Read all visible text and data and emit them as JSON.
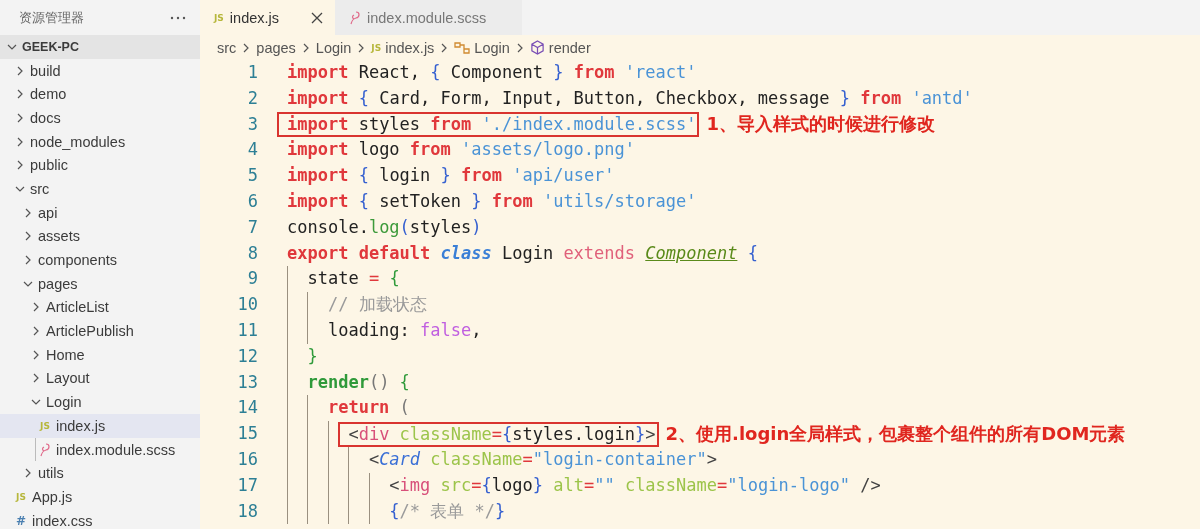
{
  "sidebar": {
    "title": "资源管理器",
    "tree": [
      {
        "label": "GEEK-PC",
        "kind": "root",
        "expanded": true,
        "selected": false,
        "children": [
          {
            "label": "build",
            "kind": "folder",
            "expanded": false,
            "selected": false
          },
          {
            "label": "demo",
            "kind": "folder",
            "expanded": false,
            "selected": false
          },
          {
            "label": "docs",
            "kind": "folder",
            "expanded": false,
            "selected": false
          },
          {
            "label": "node_modules",
            "kind": "folder",
            "expanded": false,
            "selected": false
          },
          {
            "label": "public",
            "kind": "folder",
            "expanded": false,
            "selected": false
          },
          {
            "label": "src",
            "kind": "folder",
            "expanded": true,
            "selected": false,
            "children": [
              {
                "label": "api",
                "kind": "folder",
                "expanded": false,
                "selected": false
              },
              {
                "label": "assets",
                "kind": "folder",
                "expanded": false,
                "selected": false
              },
              {
                "label": "components",
                "kind": "folder",
                "expanded": false,
                "selected": false
              },
              {
                "label": "pages",
                "kind": "folder",
                "expanded": true,
                "selected": false,
                "children": [
                  {
                    "label": "ArticleList",
                    "kind": "folder",
                    "expanded": false,
                    "selected": false
                  },
                  {
                    "label": "ArticlePublish",
                    "kind": "folder",
                    "expanded": false,
                    "selected": false
                  },
                  {
                    "label": "Home",
                    "kind": "folder",
                    "expanded": false,
                    "selected": false
                  },
                  {
                    "label": "Layout",
                    "kind": "folder",
                    "expanded": false,
                    "selected": false
                  },
                  {
                    "label": "Login",
                    "kind": "folder",
                    "expanded": true,
                    "selected": false,
                    "children": [
                      {
                        "label": "index.js",
                        "kind": "js",
                        "icon": "JS",
                        "selected": true
                      },
                      {
                        "label": "index.module.scss",
                        "kind": "scss",
                        "selected": false
                      }
                    ]
                  }
                ]
              },
              {
                "label": "utils",
                "kind": "folder",
                "expanded": false,
                "selected": false
              }
            ]
          },
          {
            "label": "App.js",
            "kind": "js",
            "icon": "JS",
            "selected": false
          },
          {
            "label": "index.css",
            "kind": "css",
            "icon": "#",
            "selected": false
          }
        ]
      }
    ]
  },
  "tabs": [
    {
      "label": "index.js",
      "kind": "js",
      "icon": "JS",
      "selected": true
    },
    {
      "label": "index.module.scss",
      "kind": "scss",
      "selected": false
    }
  ],
  "breadcrumb": [
    {
      "label": "src",
      "kind": "folder"
    },
    {
      "label": "pages",
      "kind": "folder"
    },
    {
      "label": "Login",
      "kind": "folder"
    },
    {
      "label": "index.js",
      "kind": "js",
      "icon": "JS"
    },
    {
      "label": "Login",
      "kind": "class"
    },
    {
      "label": "render",
      "kind": "method"
    }
  ],
  "code": {
    "lines": [
      {
        "number": "1",
        "tokens": [
          {
            "kind": "kw",
            "text": "import"
          },
          {
            "kind": "plain",
            "text": " React, "
          },
          {
            "kind": "brace",
            "text": "{"
          },
          {
            "kind": "plain",
            "text": " Component "
          },
          {
            "kind": "brace",
            "text": "} "
          },
          {
            "kind": "kw",
            "text": "from "
          },
          {
            "kind": "str",
            "text": "'react'"
          }
        ]
      },
      {
        "number": "2",
        "tokens": [
          {
            "kind": "kw",
            "text": "import "
          },
          {
            "kind": "brace",
            "text": "{"
          },
          {
            "kind": "plain",
            "text": " Card, Form, Input, Button, Checkbox, message "
          },
          {
            "kind": "brace",
            "text": "} "
          },
          {
            "kind": "kw",
            "text": "from "
          },
          {
            "kind": "str",
            "text": "'antd'"
          }
        ]
      },
      {
        "number": "3",
        "boxed": true,
        "annotation": "1、导入样式的时候进行修改",
        "tokens": [
          {
            "kind": "kw",
            "text": "import"
          },
          {
            "kind": "plain",
            "text": " styles "
          },
          {
            "kind": "kw",
            "text": "from "
          },
          {
            "kind": "str",
            "text": "'./index.module.scss'"
          }
        ]
      },
      {
        "number": "4",
        "tokens": [
          {
            "kind": "kw",
            "text": "import"
          },
          {
            "kind": "plain",
            "text": " logo "
          },
          {
            "kind": "kw",
            "text": "from "
          },
          {
            "kind": "str",
            "text": "'assets/logo.png'"
          }
        ]
      },
      {
        "number": "5",
        "tokens": [
          {
            "kind": "kw",
            "text": "import "
          },
          {
            "kind": "brace",
            "text": "{"
          },
          {
            "kind": "plain",
            "text": " login "
          },
          {
            "kind": "brace",
            "text": "} "
          },
          {
            "kind": "kw",
            "text": "from "
          },
          {
            "kind": "str",
            "text": "'api/user'"
          }
        ]
      },
      {
        "number": "6",
        "tokens": [
          {
            "kind": "kw",
            "text": "import "
          },
          {
            "kind": "brace",
            "text": "{"
          },
          {
            "kind": "plain",
            "text": " setToken "
          },
          {
            "kind": "brace",
            "text": "} "
          },
          {
            "kind": "kw",
            "text": "from "
          },
          {
            "kind": "str",
            "text": "'utils/storage'"
          }
        ]
      },
      {
        "number": "7",
        "tokens": [
          {
            "kind": "plain",
            "text": "console."
          },
          {
            "kind": "fn",
            "text": "log"
          },
          {
            "kind": "brace",
            "text": "("
          },
          {
            "kind": "plain",
            "text": "styles"
          },
          {
            "kind": "brace",
            "text": ")"
          }
        ]
      },
      {
        "number": "8",
        "tokens": [
          {
            "kind": "kw",
            "text": "export default "
          },
          {
            "kind": "storage",
            "text": "class"
          },
          {
            "kind": "plain",
            "text": " Login "
          },
          {
            "kind": "extends",
            "text": "extends "
          },
          {
            "kind": "type",
            "text": "Component"
          },
          {
            "kind": "brace",
            "text": " {"
          }
        ],
        "children": [
          {
            "number": "9",
            "tokens": [
              {
                "kind": "plain",
                "text": "state "
              },
              {
                "kind": "op",
                "text": "= "
              },
              {
                "kind": "brace2",
                "text": "{"
              }
            ],
            "children": [
              {
                "number": "10",
                "tokens": [
                  {
                    "kind": "comment",
                    "text": "// 加载状态"
                  }
                ]
              },
              {
                "number": "11",
                "tokens": [
                  {
                    "kind": "plain",
                    "text": "loading: "
                  },
                  {
                    "kind": "const",
                    "text": "false"
                  },
                  {
                    "kind": "plain",
                    "text": ","
                  }
                ]
              }
            ]
          },
          {
            "number": "12",
            "tokens": [
              {
                "kind": "brace2",
                "text": "}"
              }
            ]
          },
          {
            "number": "13",
            "tokens": [
              {
                "kind": "fnb",
                "text": "render"
              },
              {
                "kind": "paren",
                "text": "() "
              },
              {
                "kind": "brace2",
                "text": "{"
              }
            ],
            "children": [
              {
                "number": "14",
                "tokens": [
                  {
                    "kind": "kw",
                    "text": "return "
                  },
                  {
                    "kind": "paren",
                    "text": "("
                  }
                ],
                "children": [
                  {
                    "number": "15",
                    "boxed": true,
                    "annotation": "2、使用.login全局样式，包裹整个组件的所有DOM元素",
                    "tokens": [
                      {
                        "kind": "tagp",
                        "text": "<"
                      },
                      {
                        "kind": "tag",
                        "text": "div "
                      },
                      {
                        "kind": "attr",
                        "text": "className"
                      },
                      {
                        "kind": "op",
                        "text": "="
                      },
                      {
                        "kind": "brace",
                        "text": "{"
                      },
                      {
                        "kind": "plain",
                        "text": "styles.login"
                      },
                      {
                        "kind": "brace",
                        "text": "}"
                      },
                      {
                        "kind": "tagp",
                        "text": ">"
                      }
                    ],
                    "children": [
                      {
                        "number": "16",
                        "tokens": [
                          {
                            "kind": "tagp",
                            "text": "<"
                          },
                          {
                            "kind": "comp",
                            "text": "Card "
                          },
                          {
                            "kind": "attr",
                            "text": "className"
                          },
                          {
                            "kind": "op",
                            "text": "="
                          },
                          {
                            "kind": "str",
                            "text": "\"login-container\""
                          },
                          {
                            "kind": "tagp",
                            "text": ">"
                          }
                        ],
                        "children": [
                          {
                            "number": "17",
                            "tokens": [
                              {
                                "kind": "tagp",
                                "text": "<"
                              },
                              {
                                "kind": "tag",
                                "text": "img "
                              },
                              {
                                "kind": "attr",
                                "text": "src"
                              },
                              {
                                "kind": "op",
                                "text": "="
                              },
                              {
                                "kind": "brace",
                                "text": "{"
                              },
                              {
                                "kind": "plain",
                                "text": "logo"
                              },
                              {
                                "kind": "brace",
                                "text": "} "
                              },
                              {
                                "kind": "attr",
                                "text": "alt"
                              },
                              {
                                "kind": "op",
                                "text": "="
                              },
                              {
                                "kind": "str",
                                "text": "\"\" "
                              },
                              {
                                "kind": "attr",
                                "text": "className"
                              },
                              {
                                "kind": "op",
                                "text": "="
                              },
                              {
                                "kind": "str",
                                "text": "\"login-logo\" "
                              },
                              {
                                "kind": "tagp",
                                "text": "/>"
                              }
                            ]
                          },
                          {
                            "number": "18",
                            "tokens": [
                              {
                                "kind": "brace",
                                "text": "{"
                              },
                              {
                                "kind": "comment",
                                "text": "/* 表单 */"
                              },
                              {
                                "kind": "brace",
                                "text": "}"
                              }
                            ]
                          }
                        ]
                      }
                    ]
                  }
                ]
              }
            ]
          }
        ]
      }
    ]
  }
}
